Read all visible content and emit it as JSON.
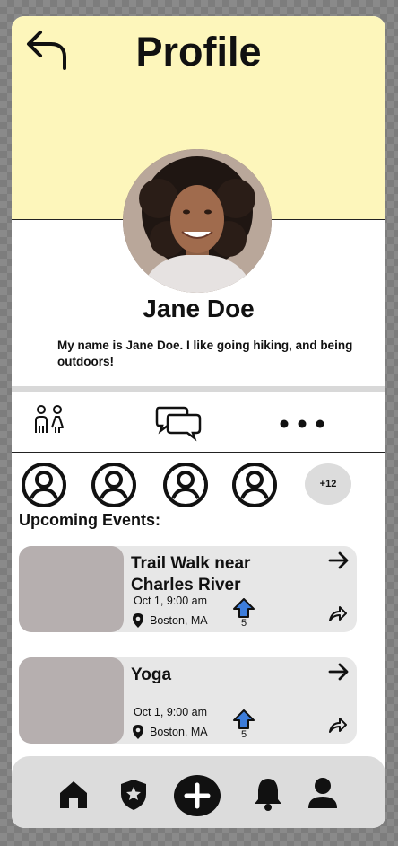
{
  "header": {
    "title": "Profile"
  },
  "profile": {
    "name": "Jane Doe",
    "bio": "My name is Jane Doe. I like going hiking, and being outdoors!"
  },
  "tabs": [
    {
      "icon": "people-icon"
    },
    {
      "icon": "chat-bubbles-icon"
    },
    {
      "icon": "more-dots-icon"
    }
  ],
  "friends": {
    "more_label": "+12"
  },
  "events_section": {
    "title": "Upcoming Events:"
  },
  "events": [
    {
      "title": "Trail Walk near Charles River",
      "date": "Oct 1, 9:00 am",
      "location": "Boston, MA",
      "upvotes": "5"
    },
    {
      "title": "Yoga",
      "date": "Oct 1, 9:00 am",
      "location": "Boston, MA",
      "upvotes": "5"
    }
  ],
  "nav": [
    "home-icon",
    "shield-star-icon",
    "add-icon",
    "bell-icon",
    "user-icon"
  ],
  "colors": {
    "header_bg": "#fdf6bb",
    "card_bg": "#e7e7e7",
    "thumb": "#b6afaf",
    "upvote_blue": "#3d7ddb"
  }
}
